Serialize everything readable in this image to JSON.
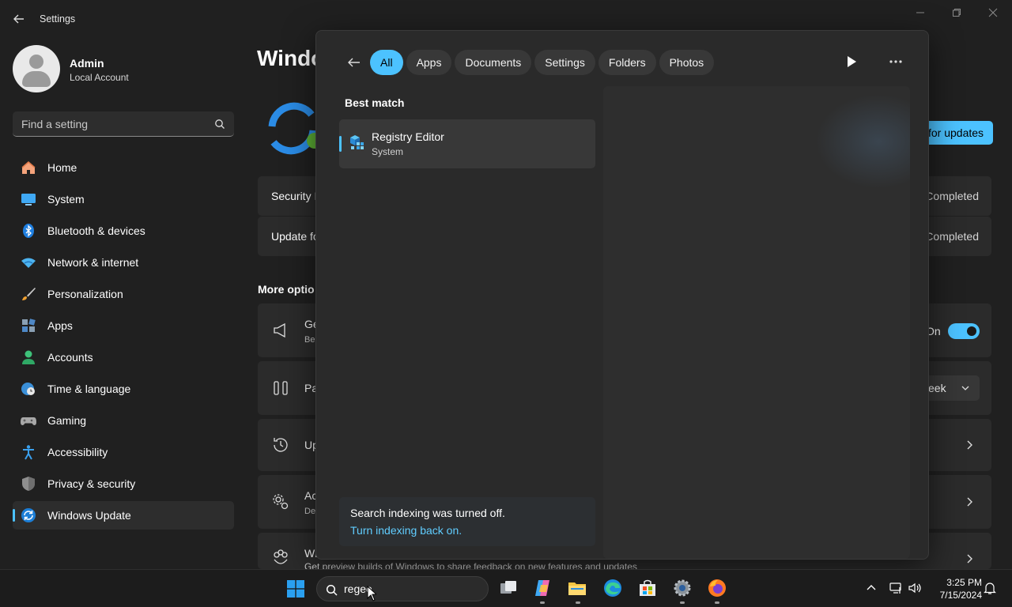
{
  "window": {
    "title": "Settings"
  },
  "profile": {
    "name": "Admin",
    "account_type": "Local Account"
  },
  "search": {
    "placeholder": "Find a setting"
  },
  "sidebar": {
    "items": [
      {
        "label": "Home",
        "icon": "home-icon"
      },
      {
        "label": "System",
        "icon": "system-icon"
      },
      {
        "label": "Bluetooth & devices",
        "icon": "bluetooth-icon"
      },
      {
        "label": "Network & internet",
        "icon": "wifi-icon"
      },
      {
        "label": "Personalization",
        "icon": "brush-icon"
      },
      {
        "label": "Apps",
        "icon": "apps-icon"
      },
      {
        "label": "Accounts",
        "icon": "accounts-icon"
      },
      {
        "label": "Time & language",
        "icon": "globe-clock-icon"
      },
      {
        "label": "Gaming",
        "icon": "gamepad-icon"
      },
      {
        "label": "Accessibility",
        "icon": "accessibility-icon"
      },
      {
        "label": "Privacy & security",
        "icon": "shield-icon"
      },
      {
        "label": "Windows Update",
        "icon": "update-icon"
      }
    ],
    "active": "Windows Update"
  },
  "main": {
    "title_partial": "Windo",
    "check_button_partial": "for updates",
    "updates": [
      {
        "name_partial": "Security I",
        "status_partial": "Completed"
      },
      {
        "name_partial": "Update fo",
        "status_partial": "Completed"
      }
    ],
    "more_options_partial": "More optio",
    "options": [
      {
        "title_partial": "Ge",
        "sub_partial": "Be",
        "icon": "megaphone-icon",
        "right_text": "On"
      },
      {
        "title_partial": "Pa",
        "icon": "pause-icon",
        "right_text": "eek"
      },
      {
        "title_partial": "Up",
        "icon": "history-icon"
      },
      {
        "title_partial": "Ac",
        "sub_partial": "De",
        "icon": "gear-advanced-icon"
      },
      {
        "title_partial": "Wi",
        "icon": "insider-icon",
        "sub": "Get preview builds of Windows to share feedback on new features and updates"
      }
    ]
  },
  "flyout": {
    "filters": [
      "All",
      "Apps",
      "Documents",
      "Settings",
      "Folders",
      "Photos"
    ],
    "active_filter": "All",
    "best_match_label": "Best match",
    "best_match": {
      "title": "Registry Editor",
      "subtitle": "System",
      "icon": "registry-editor-icon"
    },
    "notice": {
      "line1": "Search indexing was turned off.",
      "link": "Turn indexing back on."
    }
  },
  "taskbar": {
    "search_value": "regee",
    "apps": [
      "task-view-icon",
      "copilot-icon",
      "file-explorer-icon",
      "edge-icon",
      "store-icon",
      "settings-icon",
      "firefox-icon"
    ],
    "time": "3:25 PM",
    "date": "7/15/2024"
  },
  "colors": {
    "accent": "#4cc2ff",
    "link": "#60cdff",
    "background": "#202020",
    "card": "#2b2b2b"
  }
}
